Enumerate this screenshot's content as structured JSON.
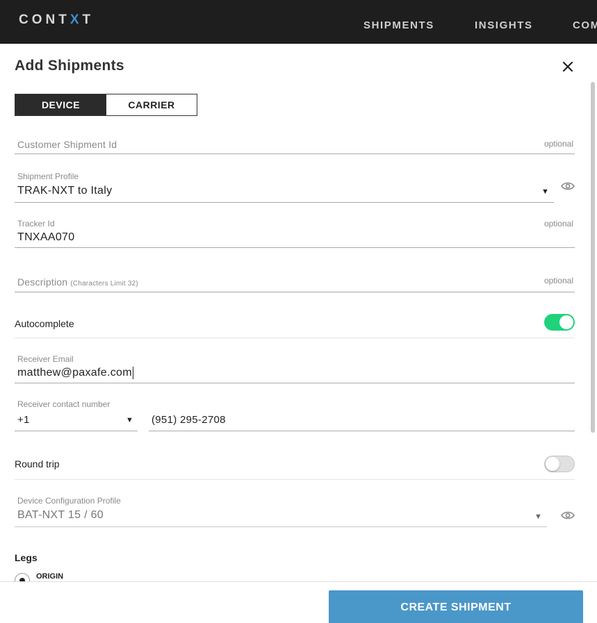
{
  "app": {
    "logo_prefix": "CONT",
    "logo_x": "X",
    "logo_suffix": "T",
    "nav": [
      "SHIPMENTS",
      "INSIGHTS",
      "COM"
    ]
  },
  "modal": {
    "title": "Add Shipments",
    "close_icon": "close-icon",
    "tabs": [
      {
        "label": "DEVICE",
        "active": true
      },
      {
        "label": "CARRIER",
        "active": false
      }
    ]
  },
  "form": {
    "customer_shipment_id": {
      "placeholder": "Customer Shipment Id",
      "optional": "optional"
    },
    "shipment_profile": {
      "label": "Shipment Profile",
      "value": "TRAK-NXT to Italy",
      "icon": "eye-icon"
    },
    "tracker_id": {
      "label": "Tracker Id",
      "value": "TNXAA070",
      "optional": "optional"
    },
    "description": {
      "placeholder": "Description",
      "hint": "(Characters Limit 32)",
      "optional": "optional"
    },
    "autocomplete": {
      "label": "Autocomplete",
      "enabled": true
    },
    "receiver_email": {
      "label": "Receiver Email",
      "value": "matthew@paxafe.com"
    },
    "receiver_contact": {
      "label": "Receiver contact number",
      "country_code": "+1",
      "number": "(951) 295-2708"
    },
    "round_trip": {
      "label": "Round trip",
      "enabled": false
    },
    "device_config": {
      "label": "Device Configuration Profile",
      "value": "BAT-NXT 15 / 60",
      "icon": "eye-icon"
    },
    "legs": {
      "label": "Legs",
      "origin_label": "ORIGIN"
    }
  },
  "footer": {
    "create_label": "CREATE SHIPMENT"
  },
  "colors": {
    "topbar": "#1e1e1e",
    "accent_toggle": "#1ed37a",
    "primary_button": "#4a97c9",
    "logo_x": "#3d8fd1"
  }
}
